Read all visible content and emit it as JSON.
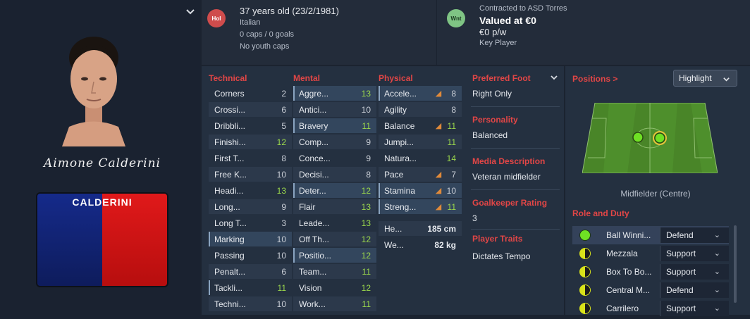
{
  "profile": {
    "signature": "Aimone Calderini",
    "shirt_name": "CALDERINI"
  },
  "bio": {
    "badge": "Hol",
    "age": "37 years old (23/2/1981)",
    "nationality": "Italian",
    "caps": "0 caps / 0 goals",
    "youth_caps": "No youth caps"
  },
  "contract": {
    "badge": "Wnt",
    "club": "Contracted to ASD Torres",
    "value": "Valued at €0",
    "wage": "€0 p/w",
    "status": "Key Player"
  },
  "attributes": {
    "technical_title": "Technical",
    "mental_title": "Mental",
    "physical_title": "Physical",
    "technical": [
      {
        "name": "Corners",
        "value": "2"
      },
      {
        "name": "Crossi...",
        "value": "6"
      },
      {
        "name": "Dribbli...",
        "value": "5"
      },
      {
        "name": "Finishi...",
        "value": "12"
      },
      {
        "name": "First T...",
        "value": "8"
      },
      {
        "name": "Free K...",
        "value": "10"
      },
      {
        "name": "Headi...",
        "value": "13"
      },
      {
        "name": "Long...",
        "value": "9"
      },
      {
        "name": "Long T...",
        "value": "3"
      },
      {
        "name": "Marking",
        "value": "10"
      },
      {
        "name": "Passing",
        "value": "10"
      },
      {
        "name": "Penalt...",
        "value": "6"
      },
      {
        "name": "Tackli...",
        "value": "11"
      },
      {
        "name": "Techni...",
        "value": "10"
      }
    ],
    "mental": [
      {
        "name": "Aggre...",
        "value": "13"
      },
      {
        "name": "Antici...",
        "value": "10"
      },
      {
        "name": "Bravery",
        "value": "11"
      },
      {
        "name": "Comp...",
        "value": "9"
      },
      {
        "name": "Conce...",
        "value": "9"
      },
      {
        "name": "Decisi...",
        "value": "8"
      },
      {
        "name": "Deter...",
        "value": "12"
      },
      {
        "name": "Flair",
        "value": "13"
      },
      {
        "name": "Leade...",
        "value": "13"
      },
      {
        "name": "Off Th...",
        "value": "12"
      },
      {
        "name": "Positio...",
        "value": "12"
      },
      {
        "name": "Team...",
        "value": "11"
      },
      {
        "name": "Vision",
        "value": "12"
      },
      {
        "name": "Work...",
        "value": "11"
      }
    ],
    "physical": [
      {
        "name": "Accele...",
        "value": "8"
      },
      {
        "name": "Agility",
        "value": "8"
      },
      {
        "name": "Balance",
        "value": "11"
      },
      {
        "name": "Jumpi...",
        "value": "11"
      },
      {
        "name": "Natura...",
        "value": "14"
      },
      {
        "name": "Pace",
        "value": "7"
      },
      {
        "name": "Stamina",
        "value": "10"
      },
      {
        "name": "Streng...",
        "value": "11"
      }
    ],
    "height_label": "He...",
    "height": "185 cm",
    "weight_label": "We...",
    "weight": "82 kg"
  },
  "info": {
    "foot_title": "Preferred Foot",
    "foot": "Right Only",
    "personality_title": "Personality",
    "personality": "Balanced",
    "media_title": "Media Description",
    "media": "Veteran midfielder",
    "gk_title": "Goalkeeper Rating",
    "gk": "3",
    "traits_title": "Player Traits",
    "traits": "Dictates Tempo"
  },
  "positions": {
    "title": "Positions >",
    "highlight_label": "Highlight",
    "position_label": "Midfielder (Centre)",
    "role_duty_title": "Role and Duty",
    "roles": [
      {
        "name": "Ball Winni...",
        "duty": "Defend"
      },
      {
        "name": "Mezzala",
        "duty": "Support"
      },
      {
        "name": "Box To Bo...",
        "duty": "Support"
      },
      {
        "name": "Central M...",
        "duty": "Defend"
      },
      {
        "name": "Carrilero",
        "duty": "Support"
      }
    ]
  },
  "colors": {
    "accent_red": "#e24646",
    "rating_green": "#9bd84c",
    "pitch_green": "#4e8f2c"
  }
}
